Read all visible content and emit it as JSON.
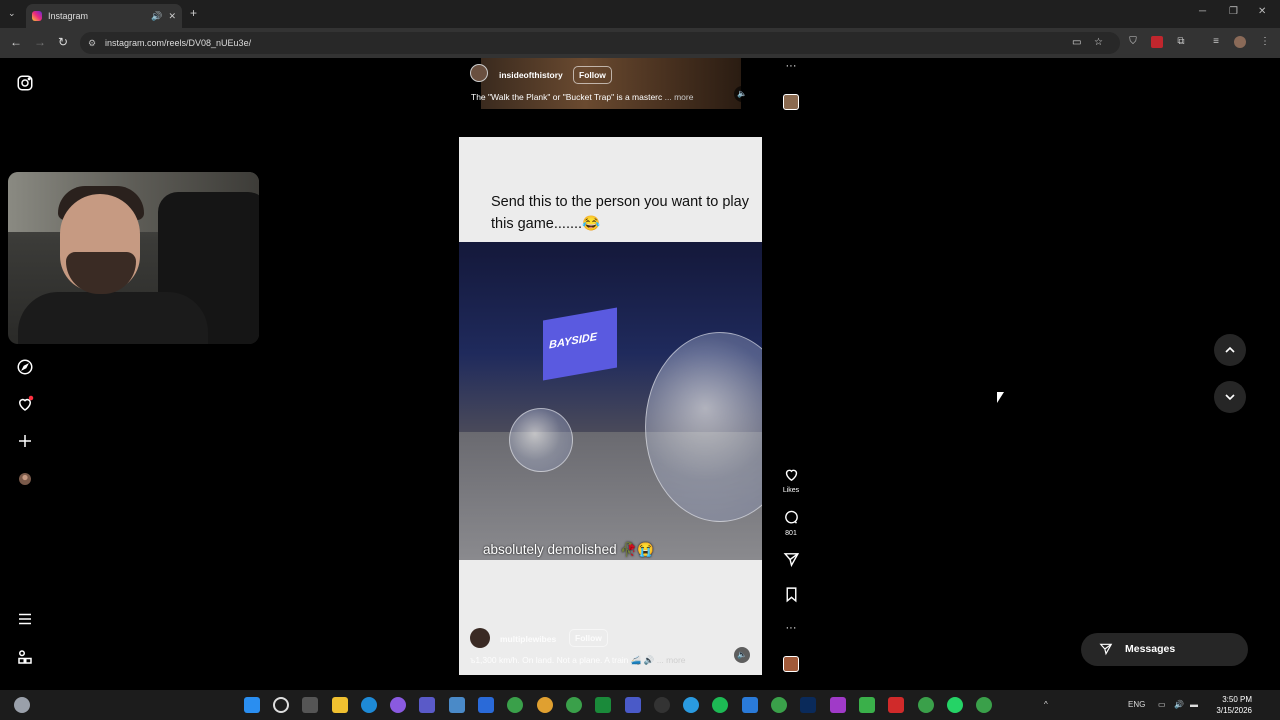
{
  "browser": {
    "tab_title": "Instagram",
    "tab_mute_icon": "speaker-icon",
    "tab_close": "✕",
    "new_tab": "+",
    "url": "instagram.com/reels/DV08_nUEu3e/",
    "window_controls": [
      "─",
      "❐",
      "✕"
    ]
  },
  "sidebar": {
    "icons": [
      "instagram-logo-icon",
      "explore-icon",
      "notifications-heart-icon",
      "create-plus-icon",
      "profile-avatar-icon",
      "menu-icon",
      "more-apps-icon"
    ]
  },
  "previous_reel": {
    "username": "insideofthistory",
    "follow_label": "Follow",
    "caption": "The \"Walk the Plank\" or \"Bucket Trap\" is a masterc",
    "more_label": "... more"
  },
  "current_reel": {
    "overlay_text": "Send this to the person you want to play this game.......😂",
    "screen_text": "BAYSIDE",
    "video_caption": "absolutely demolished 🥀😭",
    "username": "multiplewibes",
    "follow_label": "Follow",
    "caption": "ъ1,300 km/h. On land. Not a plane. A train 🚄 🔊",
    "more_label": "... more"
  },
  "actions": {
    "likes_label": "Likes",
    "comments_count": "801",
    "more_label": "···"
  },
  "messages": {
    "label": "Messages"
  },
  "taskbar": {
    "tray_lang": "ENG",
    "time": "3:50 PM",
    "date": "3/15/2026",
    "tray_chevron": "^"
  },
  "colors": {
    "background": "#000000",
    "follow_border": "#ffffff",
    "notification_dot": "#ff3040"
  }
}
